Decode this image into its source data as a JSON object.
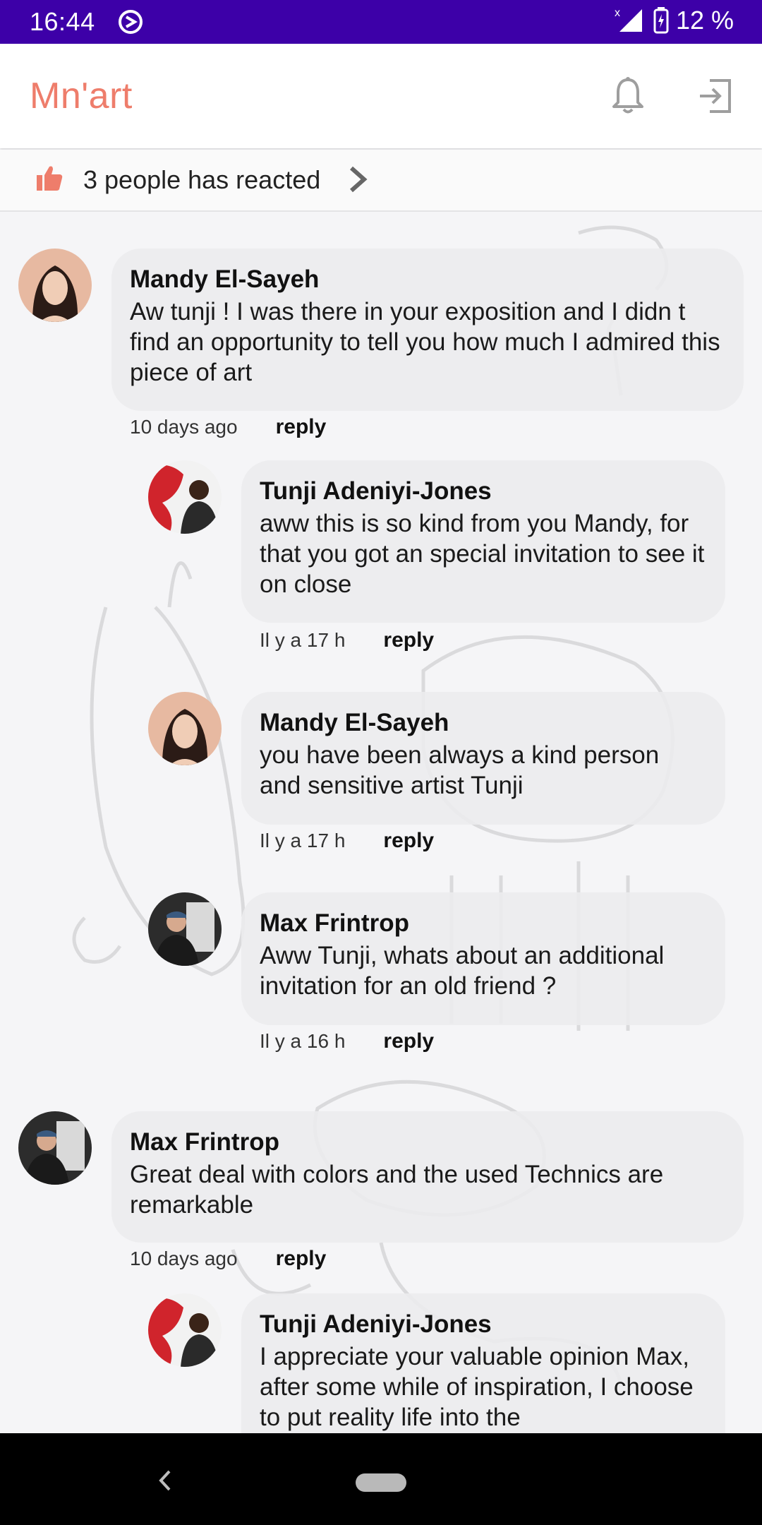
{
  "status_bar": {
    "time": "16:44",
    "battery": "12 %"
  },
  "app_bar": {
    "title": "Mn'art",
    "title_color": "#ee7d6b",
    "icons": [
      "bell-icon",
      "logout-icon"
    ]
  },
  "reactions": {
    "text": "3 people has reacted"
  },
  "comments": [
    {
      "author": "Mandy El-Sayeh",
      "text": "Aw tunji ! I was there in your exposition and I didn t find an opportunity to tell you how much I admired this piece of art",
      "time": "10 days ago",
      "reply": "reply"
    },
    {
      "author": "Tunji Adeniyi-Jones",
      "text": "aww this is so kind from you Mandy, for that you got an special invitation to see it on close",
      "time": "Il y a 17 h",
      "reply": "reply"
    },
    {
      "author": "Mandy El-Sayeh",
      "text": "you have been always a kind person and sensitive artist Tunji",
      "time": "Il y a 17 h",
      "reply": "reply"
    },
    {
      "author": "Max Frintrop",
      "text": "Aww Tunji, whats about an additional invitation for an old friend ?",
      "time": "Il y a 16 h",
      "reply": "reply"
    },
    {
      "author": "Max Frintrop",
      "text": "Great deal with colors and the used Technics are remarkable",
      "time": "10 days ago",
      "reply": "reply"
    },
    {
      "author": "Tunji Adeniyi-Jones",
      "text": "I appreciate your valuable opinion Max, after some while of inspiration, I choose to put reality life into the",
      "time": "",
      "reply": ""
    }
  ]
}
